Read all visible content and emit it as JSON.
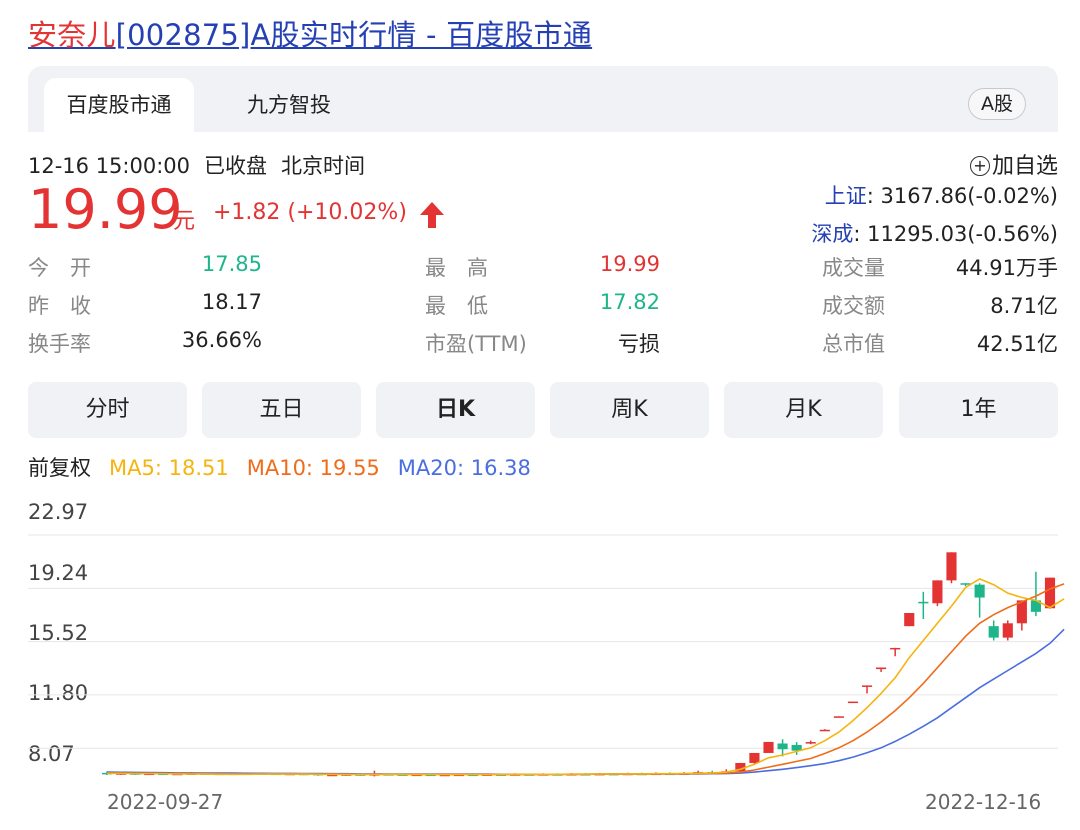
{
  "title": {
    "stock_name": "安奈儿",
    "rest": "[002875]A股实时行情 - 百度股市通"
  },
  "tabs": [
    {
      "label": "百度股市通"
    },
    {
      "label": "九方智投"
    }
  ],
  "market_badge": "A股",
  "status": {
    "time": "12-16 15:00:00",
    "state": "已收盘",
    "zone": "北京时间"
  },
  "add_watchlist": "加自选",
  "quote": {
    "price": "19.99",
    "unit": "元",
    "change": "+1.82 (+10.02%)"
  },
  "indices": [
    {
      "name": "上证",
      "value": ": 3167.86(-0.02%)"
    },
    {
      "name": "深成",
      "value": ": 11295.03(-0.56%)"
    }
  ],
  "stats": [
    {
      "label": "今　开",
      "value": "17.85",
      "color": "green"
    },
    {
      "label": "昨　收",
      "value": "18.17",
      "color": "dark"
    },
    {
      "label": "换手率",
      "value": "36.66%",
      "color": "dark"
    },
    {
      "label": "最　高",
      "value": "19.99",
      "color": "red"
    },
    {
      "label": "最　低",
      "value": "17.82",
      "color": "green"
    },
    {
      "label": "市盈(TTM)",
      "value": "亏损",
      "color": "dark"
    },
    {
      "label": "成交量",
      "value": "44.91万手",
      "color": "dark"
    },
    {
      "label": "成交额",
      "value": "8.71亿",
      "color": "dark"
    },
    {
      "label": "总市值",
      "value": "42.51亿",
      "color": "dark"
    }
  ],
  "periods": [
    {
      "label": "分时"
    },
    {
      "label": "五日"
    },
    {
      "label": "日K",
      "active": true
    },
    {
      "label": "周K"
    },
    {
      "label": "月K"
    },
    {
      "label": "1年"
    }
  ],
  "ma": {
    "label": "前复权",
    "ma5": "MA5: 18.51",
    "ma10": "MA10: 19.55",
    "ma20": "MA20: 16.38"
  },
  "colors": {
    "up": "#e33333",
    "down": "#1fb58a",
    "ma5": "#f6b40f",
    "ma10": "#ef6c1a",
    "ma20": "#4a6ee0",
    "link": "#2440b3"
  },
  "chart_data": {
    "type": "candlestick",
    "y_ticks": [
      "22.97",
      "19.24",
      "15.52",
      "11.80",
      "8.07"
    ],
    "ylim": [
      6.0,
      23.5
    ],
    "x_start_label": "2022-09-27",
    "x_end_label": "2022-12-16",
    "candles": [
      {
        "o": 6.35,
        "c": 6.3,
        "h": 6.45,
        "l": 6.2
      },
      {
        "o": 6.3,
        "c": 6.32,
        "h": 6.4,
        "l": 6.2
      },
      {
        "o": 6.32,
        "c": 6.28,
        "h": 6.4,
        "l": 6.2
      },
      {
        "o": 6.28,
        "c": 6.3,
        "h": 6.38,
        "l": 6.2
      },
      {
        "o": 6.3,
        "c": 6.27,
        "h": 6.36,
        "l": 6.2
      },
      {
        "o": 6.27,
        "c": 6.29,
        "h": 6.36,
        "l": 6.2
      },
      {
        "o": 6.29,
        "c": 6.31,
        "h": 6.4,
        "l": 6.22
      },
      {
        "o": 6.31,
        "c": 6.28,
        "h": 6.38,
        "l": 6.2
      },
      {
        "o": 6.28,
        "c": 6.3,
        "h": 6.36,
        "l": 6.22
      },
      {
        "o": 6.3,
        "c": 6.29,
        "h": 6.36,
        "l": 6.22
      },
      {
        "o": 6.29,
        "c": 6.31,
        "h": 6.38,
        "l": 6.22
      },
      {
        "o": 6.31,
        "c": 6.3,
        "h": 6.36,
        "l": 6.24
      },
      {
        "o": 6.3,
        "c": 6.28,
        "h": 6.34,
        "l": 6.22
      },
      {
        "o": 6.28,
        "c": 6.29,
        "h": 6.34,
        "l": 6.22
      },
      {
        "o": 6.29,
        "c": 6.28,
        "h": 6.34,
        "l": 6.22
      },
      {
        "o": 6.28,
        "c": 6.2,
        "h": 6.34,
        "l": 6.15
      },
      {
        "o": 6.2,
        "c": 6.22,
        "h": 6.3,
        "l": 6.15
      },
      {
        "o": 6.22,
        "c": 6.25,
        "h": 6.3,
        "l": 6.15
      },
      {
        "o": 6.25,
        "c": 6.22,
        "h": 6.32,
        "l": 6.15
      },
      {
        "o": 6.22,
        "c": 6.26,
        "h": 6.5,
        "l": 6.1
      },
      {
        "o": 6.26,
        "c": 6.24,
        "h": 6.32,
        "l": 6.18
      },
      {
        "o": 6.24,
        "c": 6.22,
        "h": 6.3,
        "l": 6.16
      },
      {
        "o": 6.22,
        "c": 6.23,
        "h": 6.3,
        "l": 6.16
      },
      {
        "o": 6.23,
        "c": 6.21,
        "h": 6.3,
        "l": 6.15
      },
      {
        "o": 6.21,
        "c": 6.22,
        "h": 6.28,
        "l": 6.15
      },
      {
        "o": 6.22,
        "c": 6.23,
        "h": 6.3,
        "l": 6.16
      },
      {
        "o": 6.23,
        "c": 6.22,
        "h": 6.3,
        "l": 6.16
      },
      {
        "o": 6.22,
        "c": 6.24,
        "h": 6.3,
        "l": 6.16
      },
      {
        "o": 6.24,
        "c": 6.23,
        "h": 6.3,
        "l": 6.18
      },
      {
        "o": 6.23,
        "c": 6.25,
        "h": 6.32,
        "l": 6.18
      },
      {
        "o": 6.25,
        "c": 6.24,
        "h": 6.3,
        "l": 6.18
      },
      {
        "o": 6.24,
        "c": 6.26,
        "h": 6.32,
        "l": 6.18
      },
      {
        "o": 6.26,
        "c": 6.25,
        "h": 6.32,
        "l": 6.18
      },
      {
        "o": 6.25,
        "c": 6.27,
        "h": 6.34,
        "l": 6.2
      },
      {
        "o": 6.27,
        "c": 6.26,
        "h": 6.34,
        "l": 6.2
      },
      {
        "o": 6.26,
        "c": 6.28,
        "h": 6.34,
        "l": 6.2
      },
      {
        "o": 6.28,
        "c": 6.27,
        "h": 6.34,
        "l": 6.2
      },
      {
        "o": 6.27,
        "c": 6.29,
        "h": 6.36,
        "l": 6.22
      },
      {
        "o": 6.29,
        "c": 6.28,
        "h": 6.36,
        "l": 6.22
      },
      {
        "o": 6.28,
        "c": 6.3,
        "h": 6.38,
        "l": 6.22
      },
      {
        "o": 6.3,
        "c": 6.29,
        "h": 6.38,
        "l": 6.22
      },
      {
        "o": 6.29,
        "c": 6.31,
        "h": 6.4,
        "l": 6.24
      },
      {
        "o": 6.31,
        "c": 6.4,
        "h": 6.5,
        "l": 6.25
      },
      {
        "o": 6.4,
        "c": 6.38,
        "h": 6.5,
        "l": 6.3
      },
      {
        "o": 6.38,
        "c": 6.46,
        "h": 6.6,
        "l": 6.3
      },
      {
        "o": 6.46,
        "c": 7.04,
        "h": 7.04,
        "l": 6.4
      },
      {
        "o": 7.04,
        "c": 7.74,
        "h": 7.74,
        "l": 7.0
      },
      {
        "o": 7.74,
        "c": 8.51,
        "h": 8.51,
        "l": 7.8
      },
      {
        "o": 8.4,
        "c": 8.0,
        "h": 8.7,
        "l": 7.5
      },
      {
        "o": 8.3,
        "c": 7.9,
        "h": 8.5,
        "l": 7.6
      },
      {
        "o": 8.4,
        "c": 8.5,
        "h": 8.6,
        "l": 8.35
      },
      {
        "o": 9.3,
        "c": 9.36,
        "h": 9.4,
        "l": 9.3
      },
      {
        "o": 10.26,
        "c": 10.3,
        "h": 10.3,
        "l": 10.26
      },
      {
        "o": 11.3,
        "c": 11.33,
        "h": 11.33,
        "l": 11.3
      },
      {
        "o": 12.4,
        "c": 12.46,
        "h": 12.46,
        "l": 11.9
      },
      {
        "o": 13.6,
        "c": 13.71,
        "h": 13.71,
        "l": 13.4
      },
      {
        "o": 15.0,
        "c": 15.08,
        "h": 15.08,
        "l": 14.5
      },
      {
        "o": 16.6,
        "c": 17.52,
        "h": 17.52,
        "l": 16.6
      },
      {
        "o": 18.3,
        "c": 18.2,
        "h": 19.0,
        "l": 17.1
      },
      {
        "o": 18.2,
        "c": 19.8,
        "h": 19.8,
        "l": 18.0
      },
      {
        "o": 19.8,
        "c": 21.76,
        "h": 21.76,
        "l": 19.6
      },
      {
        "o": 19.6,
        "c": 19.5,
        "h": 19.6,
        "l": 19.4
      },
      {
        "o": 19.5,
        "c": 18.6,
        "h": 19.6,
        "l": 17.2
      },
      {
        "o": 16.6,
        "c": 15.8,
        "h": 17.0,
        "l": 15.6
      },
      {
        "o": 15.8,
        "c": 16.8,
        "h": 17.0,
        "l": 15.6
      },
      {
        "o": 16.8,
        "c": 18.4,
        "h": 18.4,
        "l": 16.3
      },
      {
        "o": 18.4,
        "c": 17.6,
        "h": 20.4,
        "l": 17.3
      },
      {
        "o": 17.85,
        "c": 19.99,
        "h": 19.99,
        "l": 17.82
      }
    ],
    "ma5": [
      6.32,
      6.31,
      6.3,
      6.3,
      6.29,
      6.28,
      6.27,
      6.26,
      6.25,
      6.25,
      6.25,
      6.26,
      6.26,
      6.26,
      6.26,
      6.25,
      6.24,
      6.24,
      6.24,
      6.24,
      6.24,
      6.23,
      6.23,
      6.23,
      6.23,
      6.23,
      6.23,
      6.23,
      6.23,
      6.24,
      6.24,
      6.25,
      6.25,
      6.26,
      6.26,
      6.27,
      6.27,
      6.28,
      6.28,
      6.29,
      6.29,
      6.3,
      6.32,
      6.35,
      6.4,
      6.6,
      6.95,
      7.4,
      7.6,
      7.85,
      8.1,
      8.6,
      9.2,
      10.0,
      10.9,
      11.9,
      13.0,
      14.4,
      15.6,
      16.8,
      18.0,
      19.3,
      19.9,
      19.5,
      18.9,
      18.6,
      18.4,
      17.9,
      18.51
    ],
    "ma10": [
      6.34,
      6.33,
      6.32,
      6.32,
      6.31,
      6.3,
      6.3,
      6.29,
      6.28,
      6.28,
      6.27,
      6.27,
      6.27,
      6.27,
      6.26,
      6.26,
      6.26,
      6.25,
      6.25,
      6.25,
      6.25,
      6.25,
      6.24,
      6.24,
      6.24,
      6.24,
      6.24,
      6.24,
      6.24,
      6.24,
      6.24,
      6.24,
      6.25,
      6.25,
      6.25,
      6.26,
      6.26,
      6.27,
      6.27,
      6.28,
      6.28,
      6.29,
      6.3,
      6.31,
      6.33,
      6.4,
      6.55,
      6.75,
      6.95,
      7.15,
      7.35,
      7.7,
      8.1,
      8.6,
      9.2,
      9.9,
      10.7,
      11.6,
      12.6,
      13.7,
      14.8,
      15.9,
      16.8,
      17.4,
      17.9,
      18.3,
      18.7,
      19.2,
      19.55
    ],
    "ma20": [
      6.4,
      6.39,
      6.38,
      6.37,
      6.36,
      6.35,
      6.35,
      6.34,
      6.33,
      6.33,
      6.32,
      6.32,
      6.31,
      6.31,
      6.3,
      6.3,
      6.29,
      6.29,
      6.28,
      6.28,
      6.27,
      6.27,
      6.27,
      6.26,
      6.26,
      6.26,
      6.26,
      6.26,
      6.25,
      6.25,
      6.25,
      6.25,
      6.25,
      6.25,
      6.25,
      6.26,
      6.26,
      6.26,
      6.26,
      6.27,
      6.27,
      6.27,
      6.28,
      6.29,
      6.3,
      6.33,
      6.4,
      6.5,
      6.6,
      6.72,
      6.85,
      7.0,
      7.2,
      7.45,
      7.75,
      8.1,
      8.55,
      9.05,
      9.6,
      10.2,
      10.9,
      11.6,
      12.3,
      12.9,
      13.5,
      14.1,
      14.7,
      15.4,
      16.38
    ]
  }
}
